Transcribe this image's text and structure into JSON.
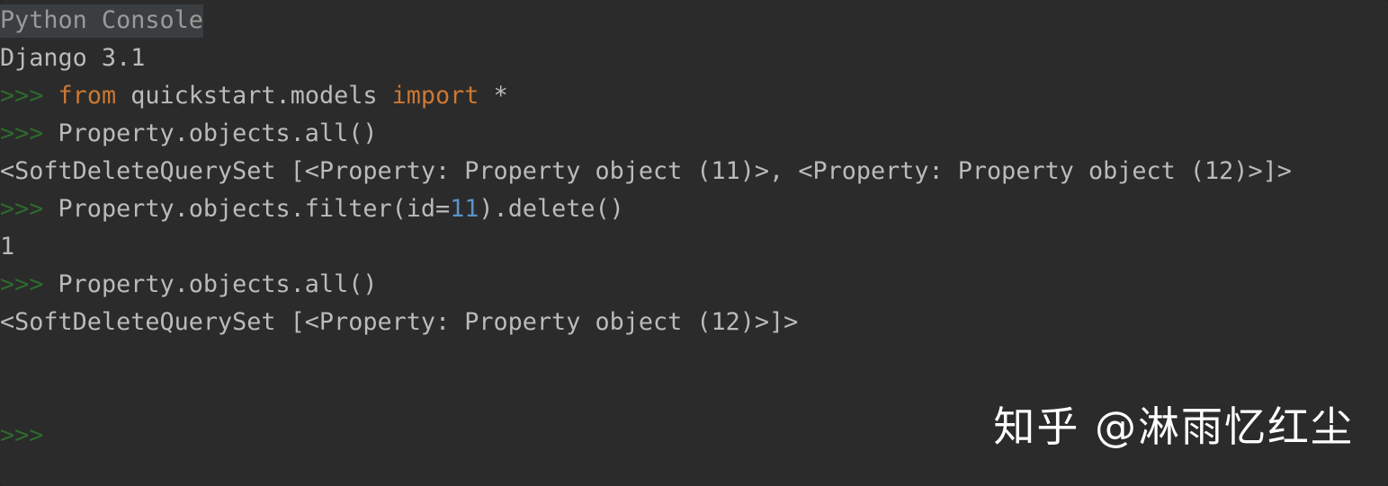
{
  "window": {
    "title": "Python Console",
    "background_color": "#2b2b2b",
    "title_highlight_color": "#3b3e40"
  },
  "colors": {
    "default_text": "#bbbbbb",
    "prompt_green": "#2d6b2d",
    "keyword_orange": "#cc7832",
    "number_blue": "#5a93c7",
    "title_gray": "#9a9a9a",
    "watermark_white": "#ffffff"
  },
  "console": {
    "title": "Python Console",
    "banner": "Django 3.1",
    "prompt_symbol": ">>>",
    "lines": [
      {
        "kind": "title",
        "segments": [
          {
            "cls": "hl",
            "text": "Python Console"
          }
        ]
      },
      {
        "kind": "banner",
        "segments": [
          {
            "cls": "plain",
            "text": "Django 3.1"
          }
        ]
      },
      {
        "kind": "input",
        "segments": [
          {
            "cls": "prompt",
            "text": ">>>"
          },
          {
            "cls": "plain",
            "text": " "
          },
          {
            "cls": "keyword",
            "text": "from"
          },
          {
            "cls": "plain",
            "text": " quickstart.models "
          },
          {
            "cls": "keyword",
            "text": "import"
          },
          {
            "cls": "plain",
            "text": " *"
          }
        ]
      },
      {
        "kind": "input",
        "segments": [
          {
            "cls": "prompt",
            "text": ">>>"
          },
          {
            "cls": "plain",
            "text": " Property.objects.all()"
          }
        ]
      },
      {
        "kind": "output",
        "segments": [
          {
            "cls": "output",
            "text": "<SoftDeleteQuerySet [<Property: Property object (11)>, <Property: Property object (12)>]>"
          }
        ]
      },
      {
        "kind": "input",
        "segments": [
          {
            "cls": "prompt",
            "text": ">>>"
          },
          {
            "cls": "plain",
            "text": " Property.objects.filter(id="
          },
          {
            "cls": "number",
            "text": "11"
          },
          {
            "cls": "plain",
            "text": ").delete()"
          }
        ]
      },
      {
        "kind": "output",
        "segments": [
          {
            "cls": "output",
            "text": "1"
          }
        ]
      },
      {
        "kind": "input",
        "segments": [
          {
            "cls": "prompt",
            "text": ">>>"
          },
          {
            "cls": "plain",
            "text": " Property.objects.all()"
          }
        ]
      },
      {
        "kind": "output",
        "segments": [
          {
            "cls": "output",
            "text": "<SoftDeleteQuerySet [<Property: Property object (12)>]>"
          }
        ]
      },
      {
        "kind": "blank",
        "segments": [
          {
            "cls": "blank",
            "text": " "
          }
        ]
      },
      {
        "kind": "blank",
        "segments": [
          {
            "cls": "blank",
            "text": " "
          }
        ]
      },
      {
        "kind": "prompt",
        "segments": [
          {
            "cls": "prompt",
            "text": ">>>"
          }
        ]
      }
    ]
  },
  "watermark": {
    "text": "知乎 @淋雨忆红尘"
  }
}
